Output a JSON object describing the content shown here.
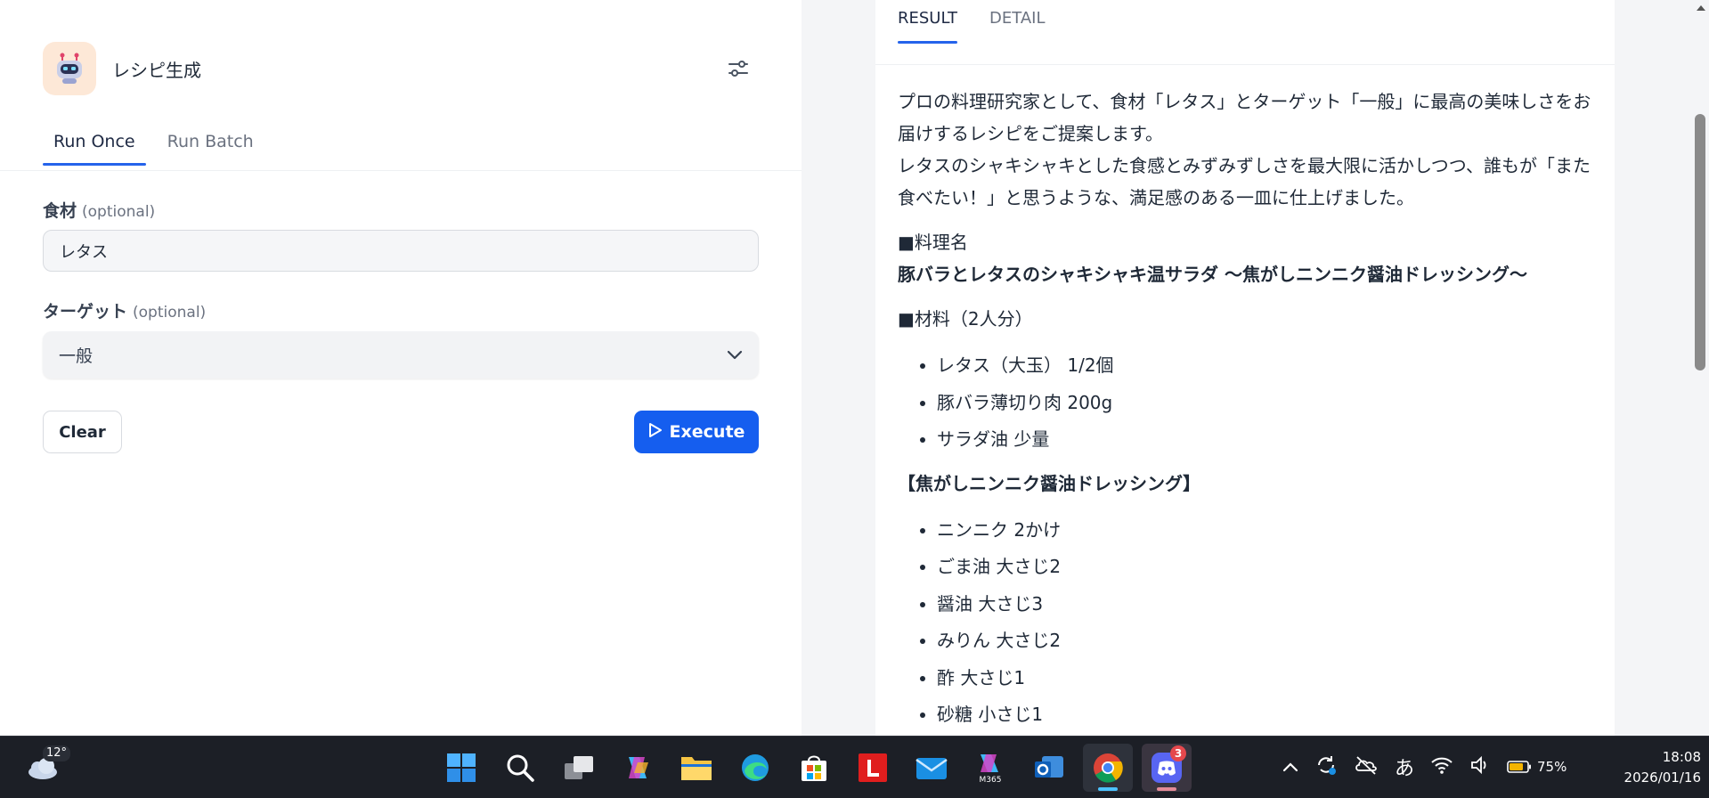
{
  "app": {
    "title": "レシピ生成",
    "tabs": [
      "Run Once",
      "Run Batch"
    ],
    "active_tab": "Run Once"
  },
  "form": {
    "ingredient": {
      "label": "食材",
      "optional": "(optional)",
      "value": "レタス"
    },
    "target": {
      "label": "ターゲット",
      "optional": "(optional)",
      "value": "一般"
    },
    "clear_label": "Clear",
    "execute_label": "Execute"
  },
  "result": {
    "tabs": [
      "RESULT",
      "DETAIL"
    ],
    "active_tab": "RESULT",
    "intro1": "プロの料理研究家として、食材「レタス」とターゲット「一般」に最高の美味しさをお届けするレシピをご提案します。",
    "intro2": "レタスのシャキシャキとした食感とみずみずしさを最大限に活かしつつ、誰もが「また食べたい！」と思うような、満足感のある一皿に仕上げました。",
    "dish_heading": "■料理名",
    "dish_name": "豚バラとレタスのシャキシャキ温サラダ 〜焦がしニンニク醤油ドレッシング〜",
    "ingredients_heading": "■材料（2人分）",
    "ingredients": [
      "レタス（大玉） 1/2個",
      "豚バラ薄切り肉 200g",
      "サラダ油 少量"
    ],
    "dressing_heading": "【焦がしニンニク醤油ドレッシング】",
    "dressing": [
      "ニンニク 2かけ",
      "ごま油 大さじ2",
      "醤油 大さじ3",
      "みりん 大さじ2",
      "酢 大さじ1",
      "砂糖 小さじ1"
    ]
  },
  "taskbar": {
    "weather_temp": "12°",
    "discord_badge": "3",
    "ime": "あ",
    "battery": "75%",
    "time": "18:08",
    "date": "2026/01/16"
  }
}
